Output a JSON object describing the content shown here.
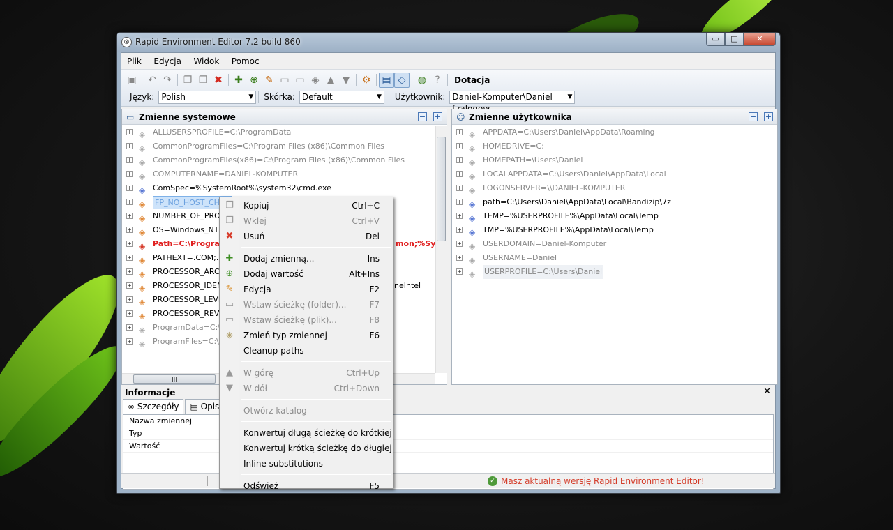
{
  "window": {
    "title": "Rapid Environment Editor 7.2 build 860",
    "controls": {
      "minimize": "▭",
      "maximize": "□",
      "close": "✕"
    }
  },
  "menubar": [
    "Plik",
    "Edycja",
    "Widok",
    "Pomoc"
  ],
  "toolbar": {
    "donate_label": "Dotacja",
    "language_label": "Język:",
    "language_value": "Polish",
    "skin_label": "Skórka:",
    "skin_value": "Default",
    "user_label": "Użytkownik:",
    "user_value": "Daniel-Komputer\\Daniel [zalogow"
  },
  "system_panel": {
    "title": "Zmienne systemowe",
    "rows": [
      {
        "text": "ALLUSERSPROFILE=C:\\ProgramData",
        "style": "gray",
        "tag": "gray"
      },
      {
        "text": "CommonProgramFiles=C:\\Program Files (x86)\\Common Files",
        "style": "gray",
        "tag": "gray"
      },
      {
        "text": "CommonProgramFiles(x86)=C:\\Program Files (x86)\\Common Files",
        "style": "gray",
        "tag": "gray"
      },
      {
        "text": "COMPUTERNAME=DANIEL-KOMPUTER",
        "style": "gray",
        "tag": "gray"
      },
      {
        "text": "ComSpec=%SystemRoot%\\system32\\cmd.exe",
        "style": "dark",
        "tag": "blue"
      },
      {
        "text": "FP_NO_HOST_CHEC",
        "style": "sel",
        "tag": "orange"
      },
      {
        "text": "NUMBER_OF_PROC",
        "style": "dark",
        "tag": "orange"
      },
      {
        "text": "OS=Windows_NT",
        "style": "dark",
        "tag": "orange"
      },
      {
        "text": "Path=C:\\Program",
        "style": "err",
        "tag": "red",
        "tail": "mon;%Sy"
      },
      {
        "text": "PATHEXT=.COM;.EX",
        "style": "dark",
        "tag": "orange"
      },
      {
        "text": "PROCESSOR_ARCH",
        "style": "dark",
        "tag": "orange"
      },
      {
        "text": "PROCESSOR_IDENT",
        "style": "dark",
        "tag": "orange",
        "tail": "neIntel"
      },
      {
        "text": "PROCESSOR_LEVEL",
        "style": "dark",
        "tag": "orange"
      },
      {
        "text": "PROCESSOR_REVIS",
        "style": "dark",
        "tag": "orange"
      },
      {
        "text": "ProgramData=C:\\Pr",
        "style": "gray",
        "tag": "gray"
      },
      {
        "text": "ProgramFiles=C:\\Pr",
        "style": "gray",
        "tag": "gray"
      }
    ]
  },
  "user_panel": {
    "title": "Zmienne użytkownika",
    "rows": [
      {
        "text": "APPDATA=C:\\Users\\Daniel\\AppData\\Roaming",
        "style": "gray",
        "tag": "gray"
      },
      {
        "text": "HOMEDRIVE=C:",
        "style": "gray",
        "tag": "gray"
      },
      {
        "text": "HOMEPATH=\\Users\\Daniel",
        "style": "gray",
        "tag": "gray"
      },
      {
        "text": "LOCALAPPDATA=C:\\Users\\Daniel\\AppData\\Local",
        "style": "gray",
        "tag": "gray"
      },
      {
        "text": "LOGONSERVER=\\\\DANIEL-KOMPUTER",
        "style": "gray",
        "tag": "gray"
      },
      {
        "text": "path=C:\\Users\\Daniel\\AppData\\Local\\Bandizip\\7z",
        "style": "dark",
        "tag": "blue"
      },
      {
        "text": "TEMP=%USERPROFILE%\\AppData\\Local\\Temp",
        "style": "dark",
        "tag": "blue"
      },
      {
        "text": "TMP=%USERPROFILE%\\AppData\\Local\\Temp",
        "style": "dark",
        "tag": "blue"
      },
      {
        "text": "USERDOMAIN=Daniel-Komputer",
        "style": "gray",
        "tag": "gray"
      },
      {
        "text": "USERNAME=Daniel",
        "style": "gray",
        "tag": "gray"
      },
      {
        "text": "USERPROFILE=C:\\Users\\Daniel",
        "style": "hl",
        "tag": "gray"
      }
    ]
  },
  "info": {
    "title": "Informacje",
    "tabs": [
      "Szczegóły",
      "Opis"
    ],
    "fields": [
      "Nazwa zmiennej",
      "Typ",
      "Wartość"
    ]
  },
  "status": {
    "message": "Masz aktualną wersję Rapid Environment Editor!"
  },
  "context_menu": [
    {
      "label": "Kopiuj",
      "key": "Ctrl+C",
      "icon": "copy-icon",
      "glyph": "❐",
      "cls": "",
      "disabled": false
    },
    {
      "label": "Wklej",
      "key": "Ctrl+V",
      "icon": "paste-icon",
      "glyph": "❐",
      "cls": "",
      "disabled": true
    },
    {
      "label": "Usuń",
      "key": "Del",
      "icon": "delete-icon",
      "glyph": "✖",
      "cls": "red",
      "disabled": false
    },
    {
      "sep": true
    },
    {
      "label": "Dodaj zmienną...",
      "key": "Ins",
      "icon": "add-variable-icon",
      "glyph": "✚",
      "cls": "green",
      "disabled": false
    },
    {
      "label": "Dodaj wartość",
      "key": "Alt+Ins",
      "icon": "add-value-icon",
      "glyph": "⊕",
      "cls": "green",
      "disabled": false
    },
    {
      "label": "Edycja",
      "key": "F2",
      "icon": "edit-icon",
      "glyph": "✎",
      "cls": "orange",
      "disabled": false
    },
    {
      "label": "Wstaw ścieżkę (folder)...",
      "key": "F7",
      "icon": "insert-folder-icon",
      "glyph": "▭",
      "cls": "",
      "disabled": true
    },
    {
      "label": "Wstaw ścieżkę (plik)...",
      "key": "F8",
      "icon": "insert-file-icon",
      "glyph": "▭",
      "cls": "",
      "disabled": true
    },
    {
      "label": "Zmień typ zmiennej",
      "key": "F6",
      "icon": "change-type-icon",
      "glyph": "◈",
      "cls": "tag",
      "disabled": false
    },
    {
      "label": "Cleanup paths",
      "key": "",
      "icon": "",
      "glyph": "",
      "cls": "",
      "disabled": false
    },
    {
      "sep": true
    },
    {
      "label": "W górę",
      "key": "Ctrl+Up",
      "icon": "arrow-up-icon",
      "glyph": "▲",
      "cls": "",
      "disabled": true
    },
    {
      "label": "W dół",
      "key": "Ctrl+Down",
      "icon": "arrow-down-icon",
      "glyph": "▼",
      "cls": "",
      "disabled": true
    },
    {
      "sep": true
    },
    {
      "label": "Otwórz katalog",
      "key": "",
      "icon": "",
      "glyph": "",
      "cls": "",
      "disabled": true
    },
    {
      "sep": true
    },
    {
      "label": "Konwertuj długą ścieżkę do krótkiej",
      "key": "",
      "icon": "",
      "glyph": "",
      "cls": "",
      "disabled": false
    },
    {
      "label": "Konwertuj krótką ścieżkę do długiej",
      "key": "",
      "icon": "",
      "glyph": "",
      "cls": "",
      "disabled": false
    },
    {
      "label": "Inline substitutions",
      "key": "",
      "icon": "",
      "glyph": "",
      "cls": "",
      "disabled": false
    },
    {
      "sep": true
    },
    {
      "label": "Odśwież",
      "key": "F5",
      "icon": "",
      "glyph": "",
      "cls": "",
      "disabled": false
    }
  ]
}
